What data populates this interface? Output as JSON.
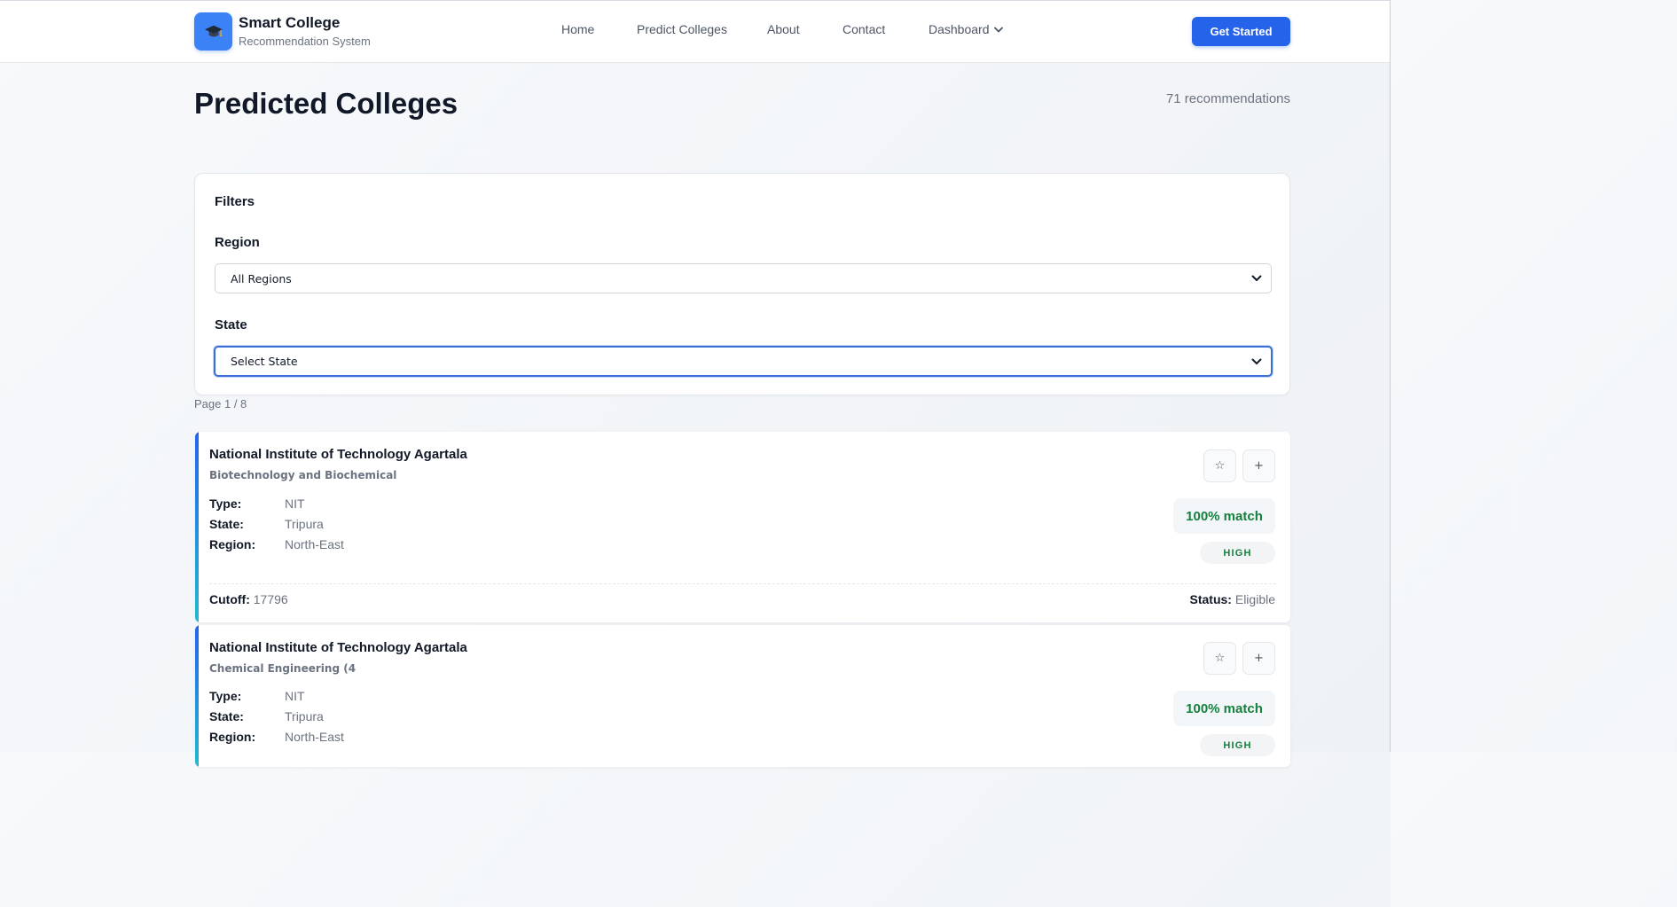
{
  "brand": {
    "title": "Smart College",
    "subtitle": "Recommendation System",
    "logo_icon": "graduation-cap-icon"
  },
  "nav": {
    "home": "Home",
    "predict": "Predict Colleges",
    "about": "About",
    "contact": "Contact",
    "dashboard": "Dashboard"
  },
  "cta": {
    "label": "Get Started",
    "color": "#2563eb"
  },
  "page": {
    "title": "Predicted Colleges",
    "recommendations": "71 recommendations",
    "page_indicator": "Page 1 / 8"
  },
  "filters": {
    "heading": "Filters",
    "region": {
      "label": "Region",
      "value": "All Regions"
    },
    "state": {
      "label": "State",
      "value": "Select State"
    }
  },
  "colleges": [
    {
      "name": "National Institute of Technology Agartala",
      "branch": "Biotechnology and Biochemical",
      "type_label": "Type:",
      "type": "NIT",
      "state_label": "State:",
      "state": "Tripura",
      "region_label": "Region:",
      "region": "North-East",
      "match": "100% match",
      "level": "HIGH",
      "cutoff_label": "Cutoff:",
      "cutoff": "17796",
      "status_label": "Status:",
      "status": "Eligible"
    },
    {
      "name": "National Institute of Technology Agartala",
      "branch": "Chemical Engineering (4",
      "type_label": "Type:",
      "type": "NIT",
      "state_label": "State:",
      "state": "Tripura",
      "region_label": "Region:",
      "region": "North-East",
      "match": "100% match",
      "level": "HIGH"
    }
  ],
  "card_actions": {
    "favorite_icon": "star-icon",
    "add_icon": "plus-icon",
    "favorite": "☆",
    "add": "+"
  },
  "colors": {
    "match_green": "#15803d",
    "accent_blue": "#2563eb",
    "accent_teal": "#22b8cf"
  }
}
